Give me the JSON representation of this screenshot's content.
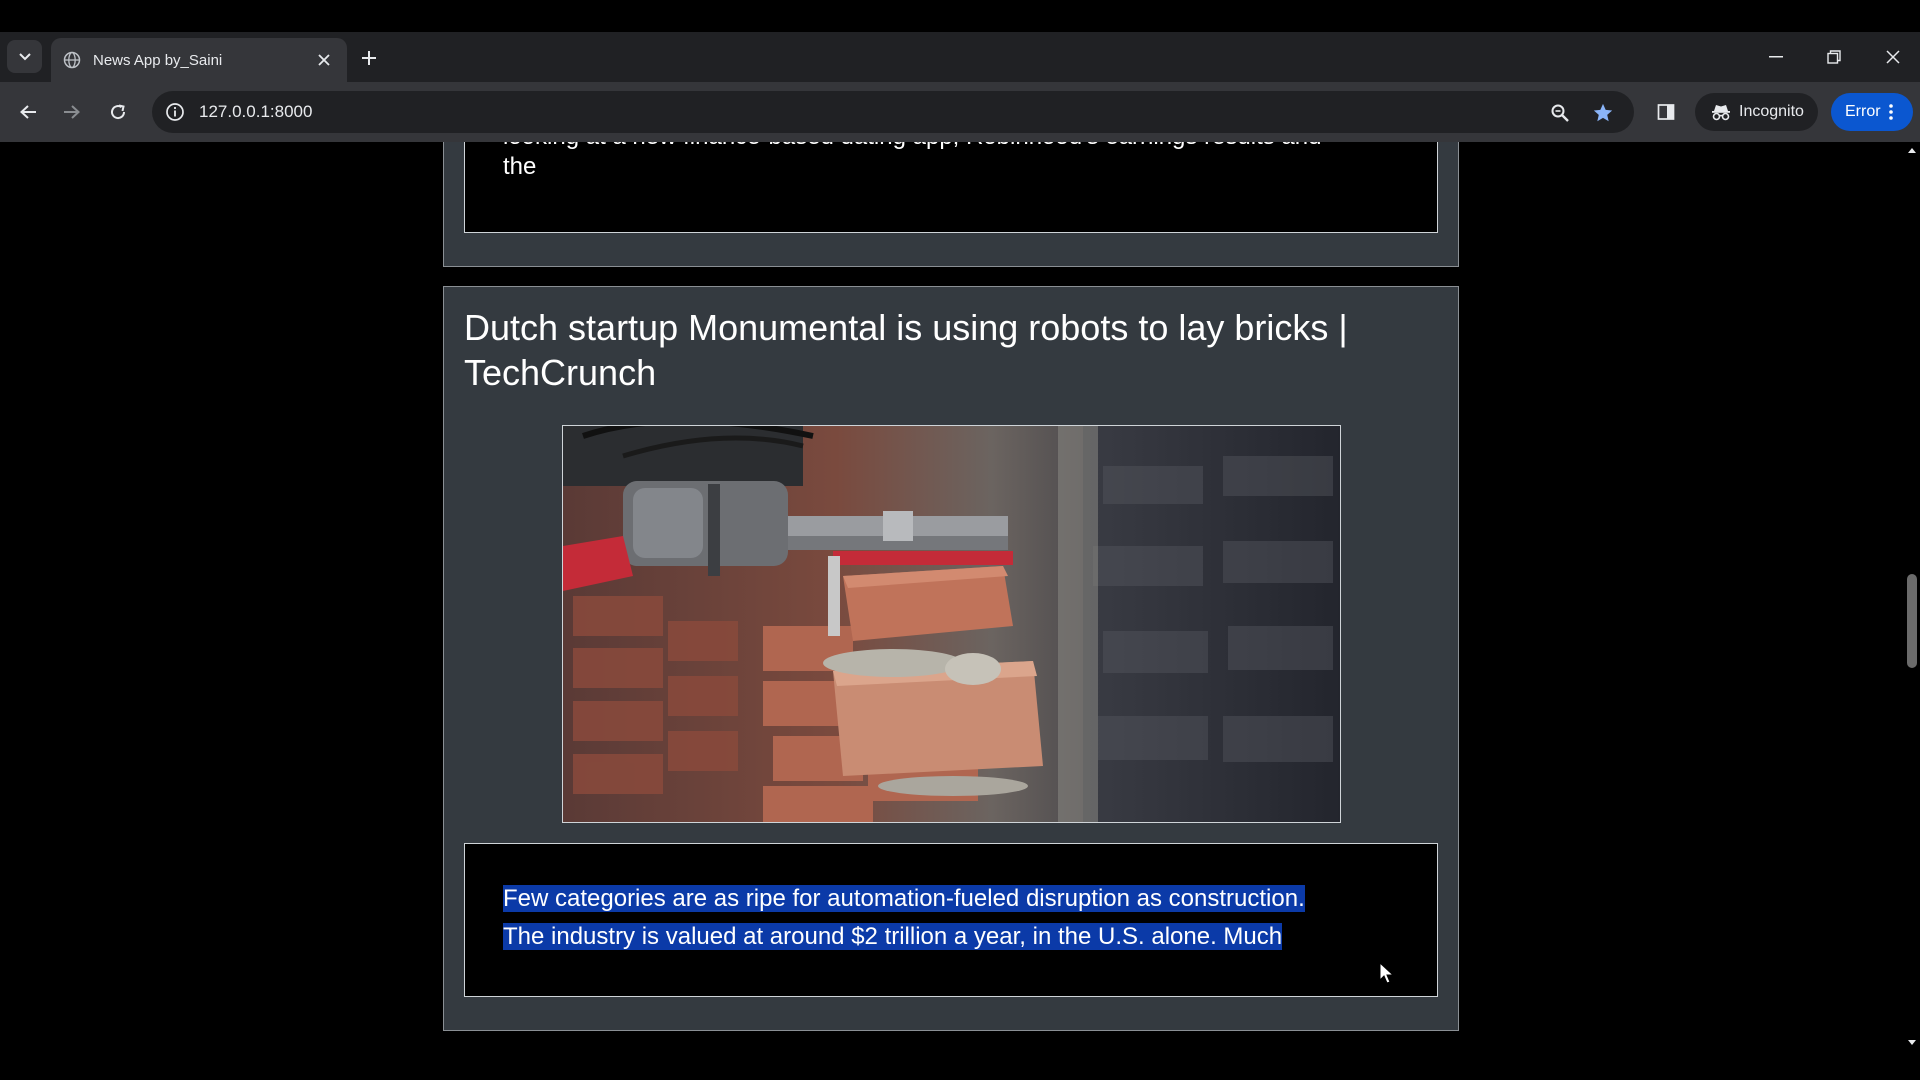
{
  "browser": {
    "tab_title": "News App by_Saini",
    "url": "127.0.0.1:8000",
    "incognito_label": "Incognito",
    "error_label": "Error"
  },
  "previous_article": {
    "description_partial": "looking at a new finance-based dating app, Robinhood's earnings results and",
    "description_end": "the"
  },
  "article": {
    "title": "Dutch startup Monumental is using robots to lay bricks | TechCrunch",
    "image_alt": "Robot arm laying bricks",
    "description_line1": "Few categories are as ripe for automation-fueled disruption as construction.",
    "description_line2": "The industry is valued at around $2 trillion a year, in the U.S. alone. Much"
  },
  "colors": {
    "chrome_dark": "#202124",
    "chrome_mid": "#35363a",
    "card_bg": "#343a40",
    "accent_blue": "#0b57d0",
    "selection": "#0b3aa8"
  }
}
